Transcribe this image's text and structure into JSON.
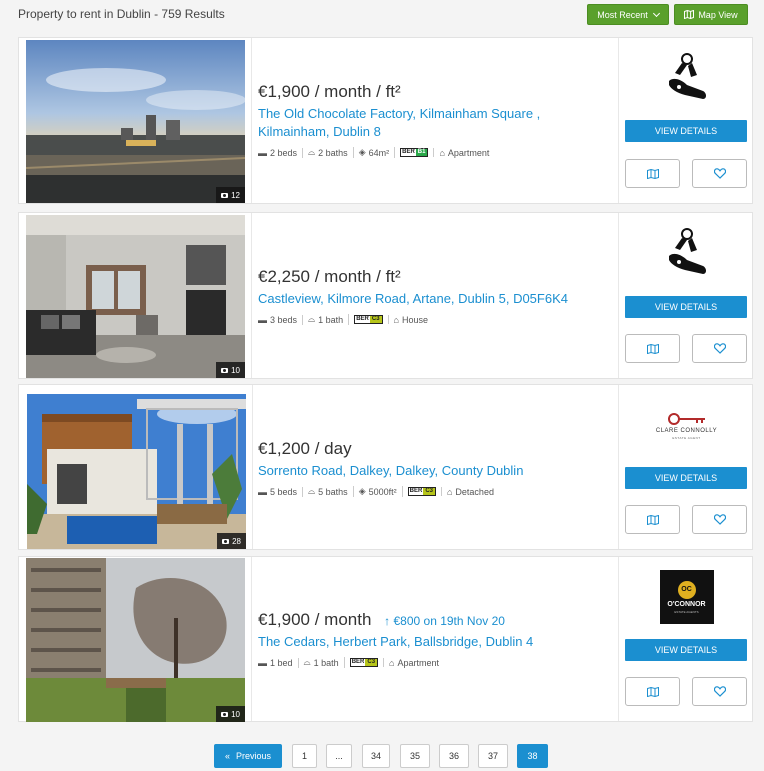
{
  "header": {
    "title": "Property to rent in Dublin - 759 Results",
    "sort_label": "Most Recent",
    "map_label": "Map View"
  },
  "listings": [
    {
      "price": "€1,900 / month / ft²",
      "price_change": "",
      "address_line1": "The Old Chocolate Factory, Kilmainham Square ,",
      "address_line2": "Kilmainham, Dublin 8",
      "photos": "12",
      "beds": "2 beds",
      "baths": "2 baths",
      "size": "64m²",
      "ber": "B1",
      "ber_color": "#2aa84a",
      "type": "Apartment",
      "agent": "keys-logo",
      "view_label": "VIEW DETAILS"
    },
    {
      "price": "€2,250 / month / ft²",
      "price_change": "",
      "address_line1": "Castleview, Kilmore Road, Artane, Dublin 5, D05F6K4",
      "address_line2": "",
      "photos": "10",
      "beds": "3 beds",
      "baths": "1 bath",
      "size": "",
      "ber": "C3",
      "ber_color": "#b6c51a",
      "type": "House",
      "agent": "keys-logo",
      "view_label": "VIEW DETAILS"
    },
    {
      "price": "€1,200 / day",
      "price_change": "",
      "address_line1": "Sorrento Road, Dalkey, Dalkey, County Dublin",
      "address_line2": "",
      "photos": "28",
      "beds": "5 beds",
      "baths": "5 baths",
      "size": "5000ft²",
      "ber": "C3",
      "ber_color": "#b6c51a",
      "type": "Detached",
      "agent": "CLARE CONNOLLY",
      "agent_sub": "ESTATE AGENT",
      "view_label": "VIEW DETAILS"
    },
    {
      "price": "€1,900 / month",
      "price_change": "€800 on 19th Nov 20",
      "address_line1": "The Cedars, Herbert Park, Ballsbridge, Dublin 4",
      "address_line2": "",
      "photos": "10",
      "beds": "1 bed",
      "baths": "1 bath",
      "size": "",
      "ber": "C3",
      "ber_color": "#b6c51a",
      "type": "Apartment",
      "agent": "O'CONNOR",
      "agent_mark": "OC",
      "agent_sub": "ESTATE AGENTS",
      "view_label": "VIEW DETAILS"
    }
  ],
  "pagination": {
    "previous": "Previous",
    "pages": [
      "1",
      "...",
      "34",
      "35",
      "36",
      "37",
      "38"
    ],
    "current": "38"
  },
  "colors": {
    "accent": "#1b8fd0",
    "green": "#5aa02c"
  }
}
